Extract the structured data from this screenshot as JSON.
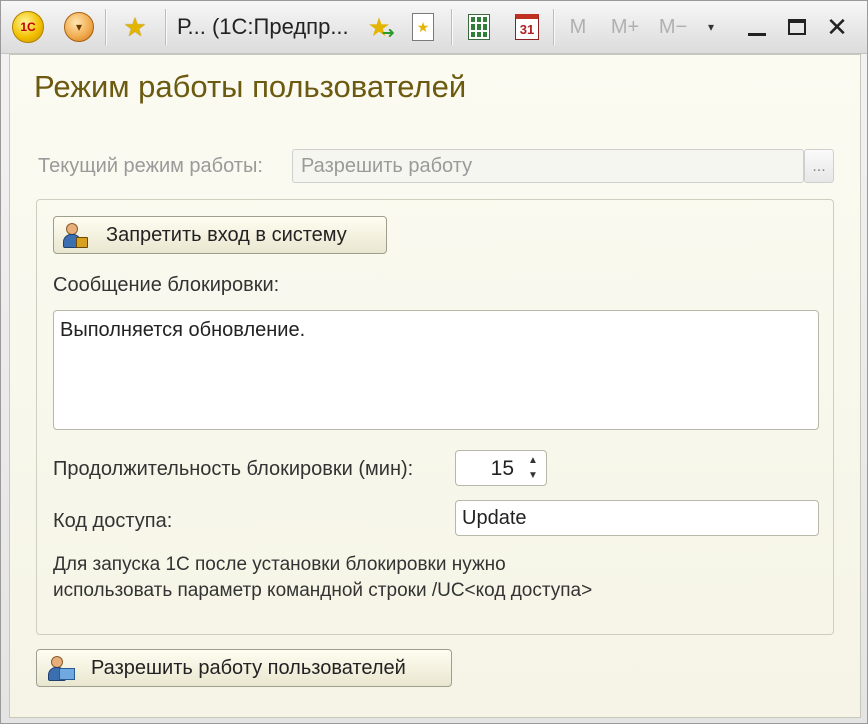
{
  "titlebar": {
    "logo_text": "1С",
    "title": "Р...  (1С:Предпр...",
    "calendar_day": "31",
    "m_label": "M",
    "m_plus_label": "M+",
    "m_minus_label": "M−",
    "dropdown_glyph": "▾",
    "close_glyph": "✕"
  },
  "form": {
    "heading": "Режим работы пользователей",
    "current_mode_label": "Текущий режим работы:",
    "current_mode_value": "Разрешить работу",
    "current_mode_choose": "...",
    "lock_button_label": "Запретить вход в систему",
    "message_label": "Сообщение блокировки:",
    "message_value": "Выполняется обновление.",
    "duration_label": "Продолжительность блокировки (мин):",
    "duration_value": "15",
    "access_code_label": "Код доступа:",
    "access_code_value": "Update",
    "hint_line1": "Для запуска 1С после установки блокировки нужно",
    "hint_line2": "использовать параметр командной строки /UC<код доступа>",
    "allow_button_label": "Разрешить работу пользователей"
  },
  "icons": {
    "logo": "1c-logo-icon",
    "menu": "main-menu-icon",
    "favorites": "star-icon",
    "add_favorite": "star-arrow-icon",
    "favorite_doc": "star-document-icon",
    "calculator": "calculator-icon",
    "calendar": "calendar-icon",
    "lock_user": "user-lock-icon",
    "allow_user": "user-computer-icon"
  },
  "colors": {
    "heading": "#6b5a10",
    "form_background": "#f8f7ec",
    "disabled_text": "#9a9a9a"
  }
}
